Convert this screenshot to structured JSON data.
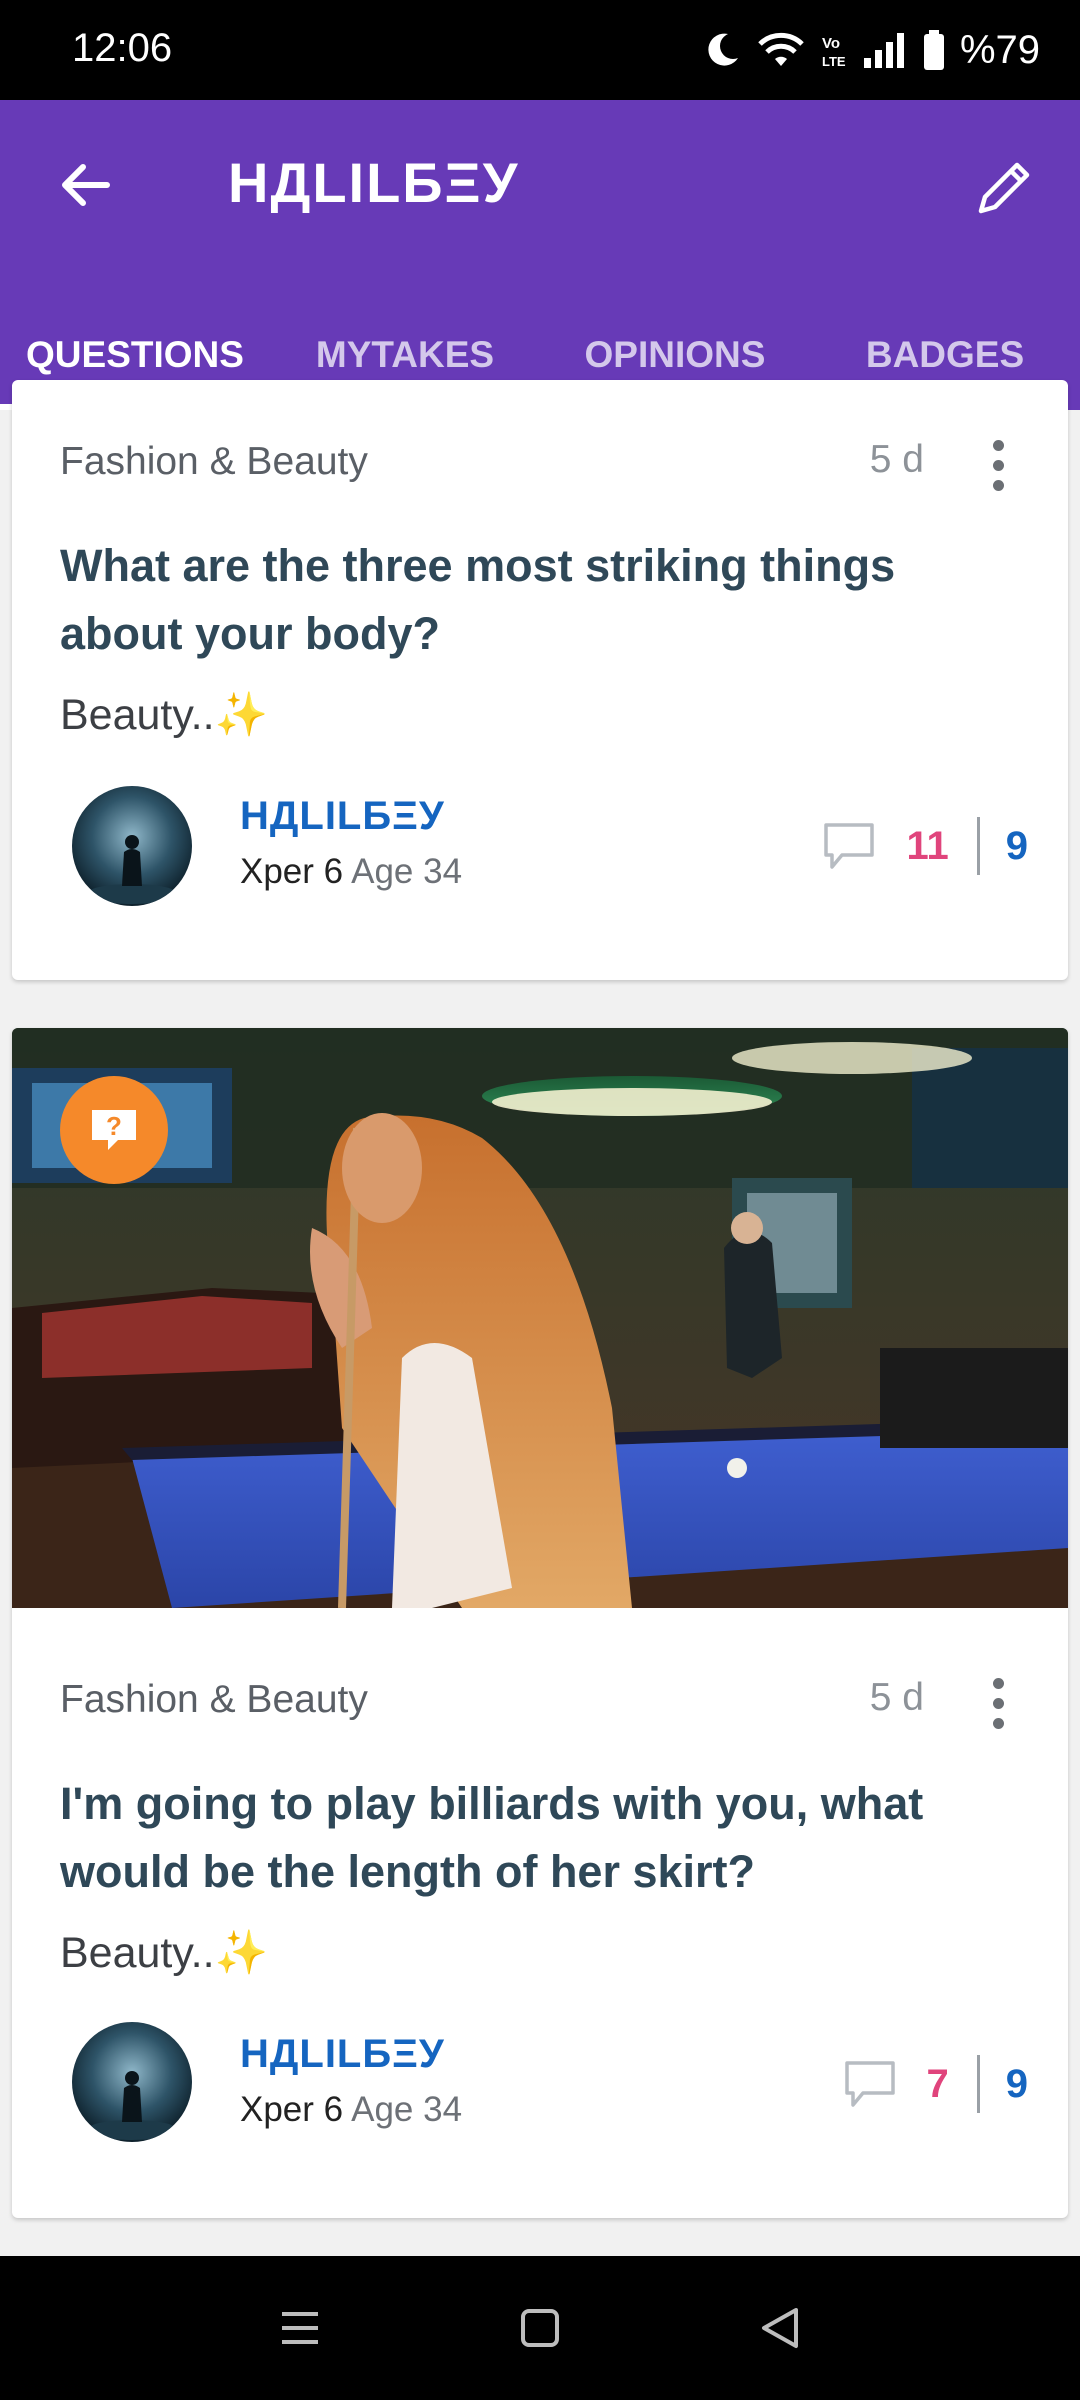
{
  "status_bar": {
    "time": "12:06",
    "battery_text": "%79",
    "icons": [
      "moon-icon",
      "wifi-icon",
      "volte-icon",
      "signal-icon",
      "battery-icon"
    ]
  },
  "header": {
    "title": "НДLILБΞУ",
    "back_icon": "arrow-left-icon",
    "edit_icon": "pencil-icon"
  },
  "tabs": [
    {
      "label": "QUESTIONS",
      "active": true
    },
    {
      "label": "MYTAKES",
      "active": false
    },
    {
      "label": "OPINIONS",
      "active": false
    },
    {
      "label": "BADGES",
      "active": false
    }
  ],
  "questions": [
    {
      "category": "Fashion & Beauty",
      "time": "5 d",
      "title": "What are the three most striking things about your body?",
      "description": "Beauty..✨",
      "user": {
        "name": "НДLILБΞУ",
        "level": "Xper 6",
        "age": "Age 34"
      },
      "answers": "11",
      "views": "9",
      "has_photo": false
    },
    {
      "category": "Fashion & Beauty",
      "time": "5 d",
      "title": "I'm going to play billiards with you, what would be the length of her skirt?",
      "description": "Beauty..✨",
      "user": {
        "name": "НДLILБΞУ",
        "level": "Xper 6",
        "age": "Age 34"
      },
      "answers": "7",
      "views": "9",
      "has_photo": true,
      "badge_text": "?"
    }
  ],
  "colors": {
    "appbar": "#673ab7",
    "answers": "#e0447c",
    "username": "#1565c0",
    "question_badge": "#f5892a"
  },
  "navbar": [
    "menu-icon",
    "home-square-icon",
    "back-triangle-icon"
  ]
}
